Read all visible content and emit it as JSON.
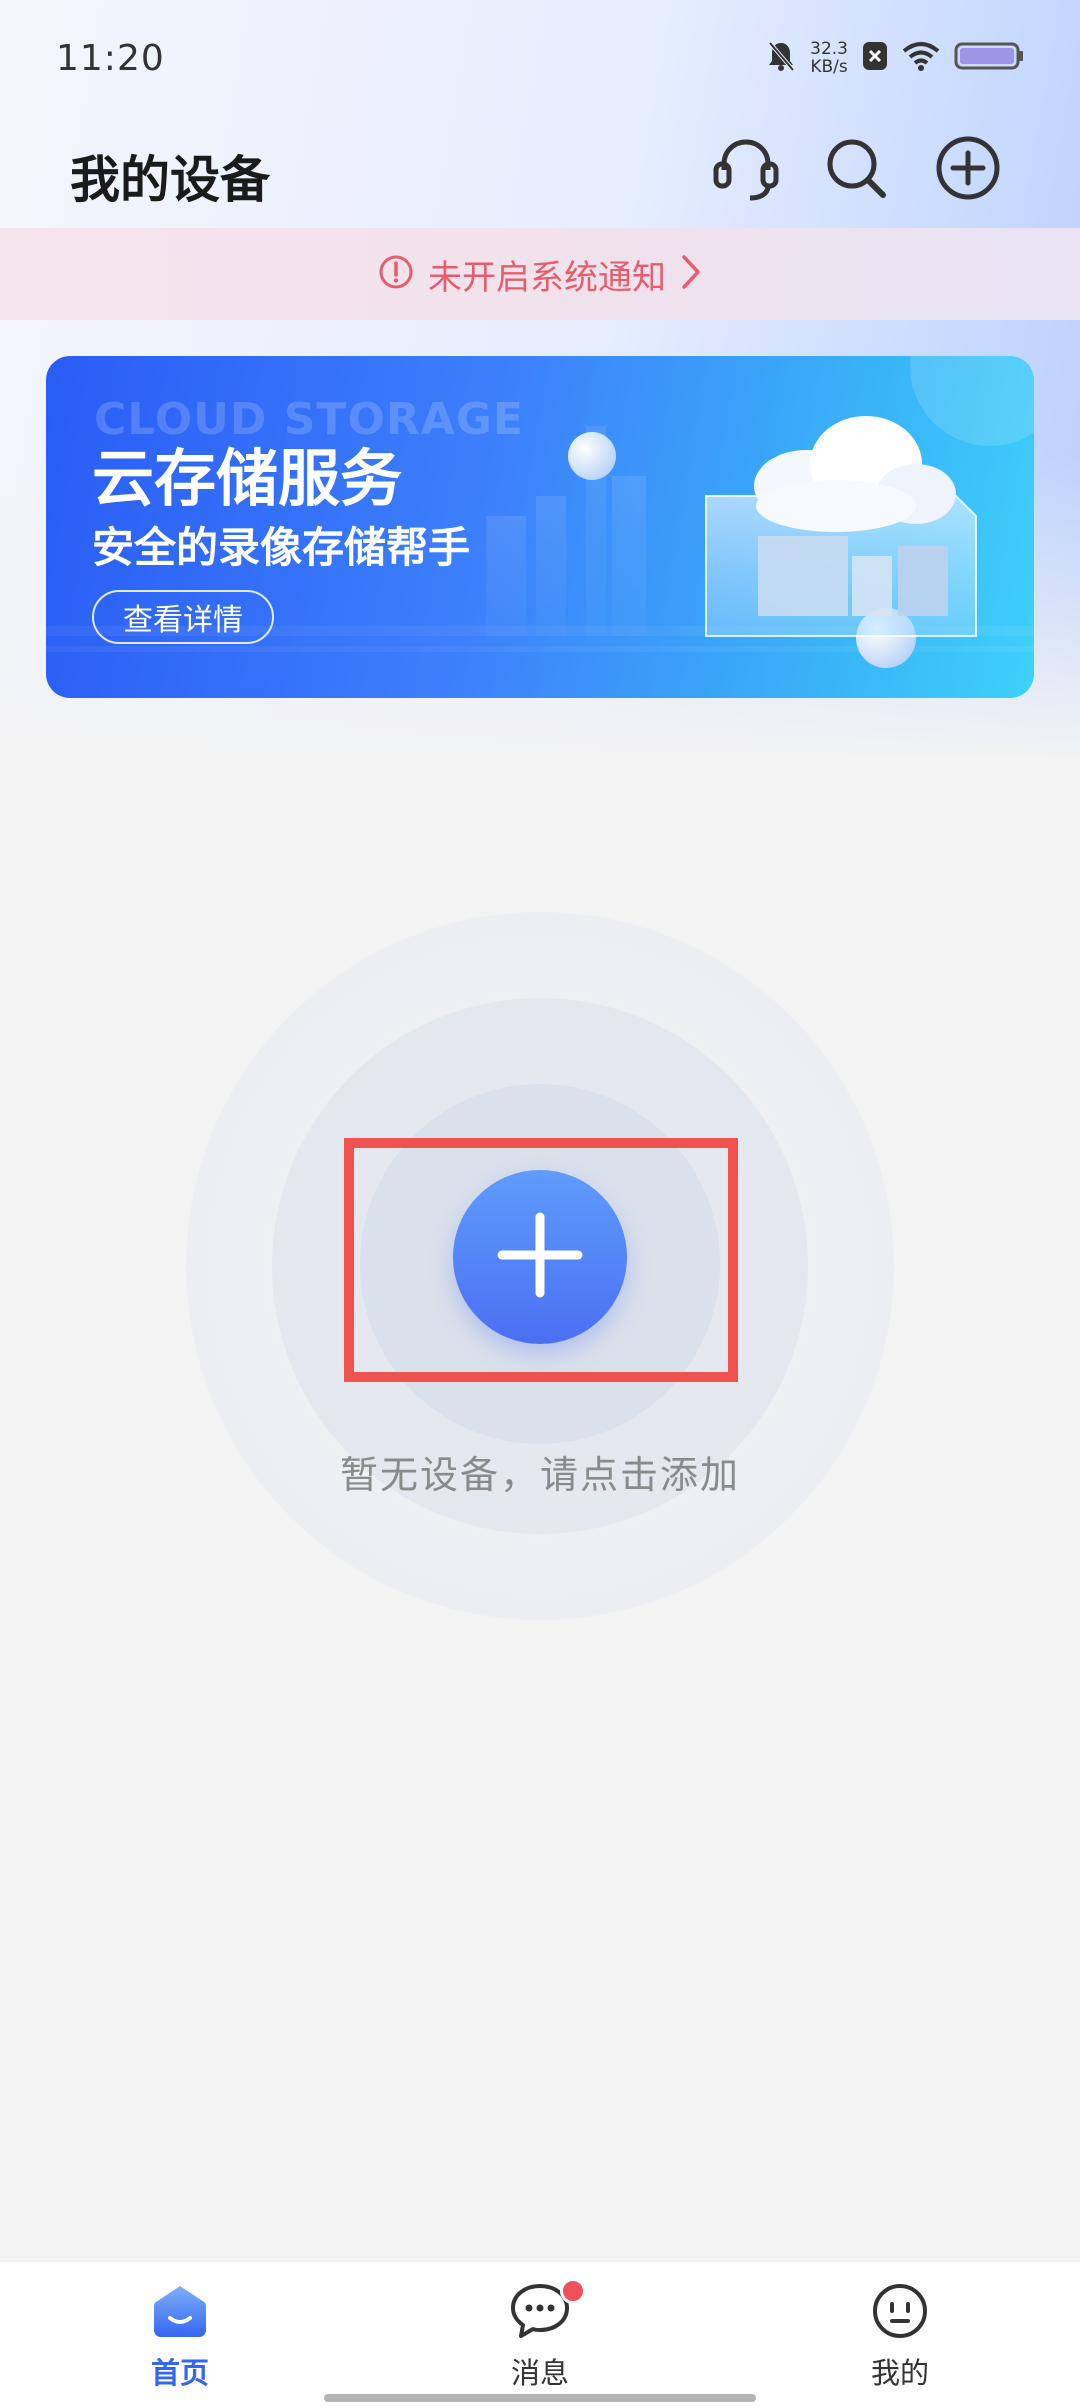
{
  "status_bar": {
    "time": "11:20",
    "net_speed_value": "32.3",
    "net_speed_unit": "KB/s",
    "icons": [
      "mute-bell-icon",
      "app-notification-icon",
      "wifi-icon",
      "battery-icon"
    ]
  },
  "header": {
    "title": "我的设备",
    "icons": [
      "headset-support-icon",
      "search-icon",
      "add-circle-icon"
    ]
  },
  "notice": {
    "text": "未开启系统通知",
    "icon": "alert-circle-icon",
    "chevron": "chevron-right-icon",
    "color": "#e85c6d"
  },
  "banner": {
    "watermark": "CLOUD STORAGE",
    "title": "云存储服务",
    "subtitle": "安全的录像存储帮手",
    "button_label": "查看详情"
  },
  "empty_state": {
    "message": "暂无设备，请点击添加",
    "add_icon": "plus-icon"
  },
  "tabs": [
    {
      "label": "首页",
      "icon": "home-icon",
      "active": true
    },
    {
      "label": "消息",
      "icon": "chat-bubble-icon",
      "active": false,
      "has_badge": true
    },
    {
      "label": "我的",
      "icon": "smiley-face-icon",
      "active": false
    }
  ],
  "colors": {
    "accent": "#3566f0",
    "highlight_border": "#ef5350",
    "badge": "#f0505c"
  }
}
